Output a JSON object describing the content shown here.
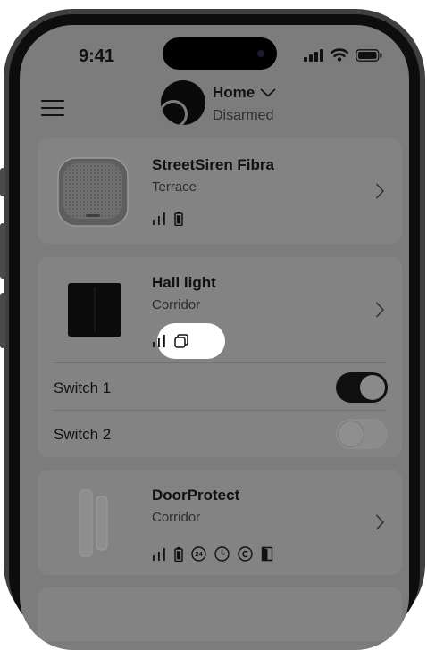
{
  "status_bar": {
    "time": "9:41"
  },
  "header": {
    "hub_name": "Home",
    "hub_status": "Disarmed"
  },
  "devices": [
    {
      "name": "StreetSiren Fibra",
      "room": "Terrace",
      "icons": [
        "signal-icon",
        "battery-icon"
      ]
    },
    {
      "name": "Hall light",
      "room": "Corridor",
      "icons": [
        "signal-icon",
        "two-gang-icon"
      ],
      "switches": [
        {
          "label": "Switch 1",
          "on": true
        },
        {
          "label": "Switch 2",
          "on": false
        }
      ]
    },
    {
      "name": "DoorProtect",
      "room": "Corridor",
      "icons": [
        "signal-icon",
        "battery-icon",
        "24h-zone-icon",
        "delay-icon",
        "chime-icon",
        "door-icon"
      ]
    }
  ],
  "colors": {
    "overlay": "#7c7c7c",
    "card": "#838383",
    "highlight": "#ffffff",
    "text": "#111111"
  }
}
